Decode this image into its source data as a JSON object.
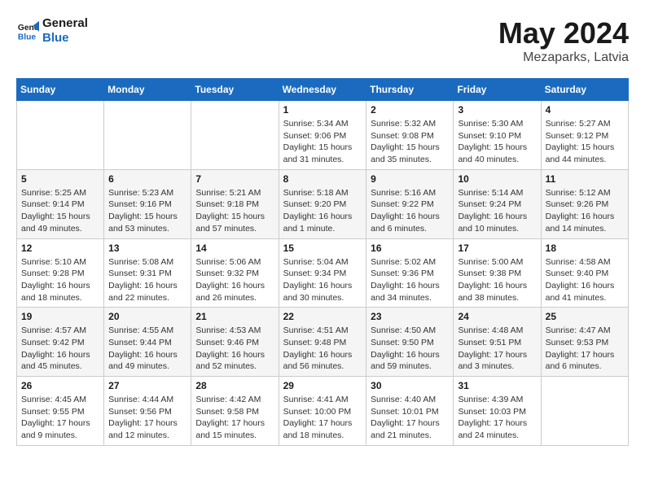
{
  "header": {
    "logo_line1": "General",
    "logo_line2": "Blue",
    "month": "May 2024",
    "location": "Mezaparks, Latvia"
  },
  "columns": [
    "Sunday",
    "Monday",
    "Tuesday",
    "Wednesday",
    "Thursday",
    "Friday",
    "Saturday"
  ],
  "weeks": [
    [
      {
        "day": "",
        "info": ""
      },
      {
        "day": "",
        "info": ""
      },
      {
        "day": "",
        "info": ""
      },
      {
        "day": "1",
        "info": "Sunrise: 5:34 AM\nSunset: 9:06 PM\nDaylight: 15 hours and 31 minutes."
      },
      {
        "day": "2",
        "info": "Sunrise: 5:32 AM\nSunset: 9:08 PM\nDaylight: 15 hours and 35 minutes."
      },
      {
        "day": "3",
        "info": "Sunrise: 5:30 AM\nSunset: 9:10 PM\nDaylight: 15 hours and 40 minutes."
      },
      {
        "day": "4",
        "info": "Sunrise: 5:27 AM\nSunset: 9:12 PM\nDaylight: 15 hours and 44 minutes."
      }
    ],
    [
      {
        "day": "5",
        "info": "Sunrise: 5:25 AM\nSunset: 9:14 PM\nDaylight: 15 hours and 49 minutes."
      },
      {
        "day": "6",
        "info": "Sunrise: 5:23 AM\nSunset: 9:16 PM\nDaylight: 15 hours and 53 minutes."
      },
      {
        "day": "7",
        "info": "Sunrise: 5:21 AM\nSunset: 9:18 PM\nDaylight: 15 hours and 57 minutes."
      },
      {
        "day": "8",
        "info": "Sunrise: 5:18 AM\nSunset: 9:20 PM\nDaylight: 16 hours and 1 minute."
      },
      {
        "day": "9",
        "info": "Sunrise: 5:16 AM\nSunset: 9:22 PM\nDaylight: 16 hours and 6 minutes."
      },
      {
        "day": "10",
        "info": "Sunrise: 5:14 AM\nSunset: 9:24 PM\nDaylight: 16 hours and 10 minutes."
      },
      {
        "day": "11",
        "info": "Sunrise: 5:12 AM\nSunset: 9:26 PM\nDaylight: 16 hours and 14 minutes."
      }
    ],
    [
      {
        "day": "12",
        "info": "Sunrise: 5:10 AM\nSunset: 9:28 PM\nDaylight: 16 hours and 18 minutes."
      },
      {
        "day": "13",
        "info": "Sunrise: 5:08 AM\nSunset: 9:31 PM\nDaylight: 16 hours and 22 minutes."
      },
      {
        "day": "14",
        "info": "Sunrise: 5:06 AM\nSunset: 9:32 PM\nDaylight: 16 hours and 26 minutes."
      },
      {
        "day": "15",
        "info": "Sunrise: 5:04 AM\nSunset: 9:34 PM\nDaylight: 16 hours and 30 minutes."
      },
      {
        "day": "16",
        "info": "Sunrise: 5:02 AM\nSunset: 9:36 PM\nDaylight: 16 hours and 34 minutes."
      },
      {
        "day": "17",
        "info": "Sunrise: 5:00 AM\nSunset: 9:38 PM\nDaylight: 16 hours and 38 minutes."
      },
      {
        "day": "18",
        "info": "Sunrise: 4:58 AM\nSunset: 9:40 PM\nDaylight: 16 hours and 41 minutes."
      }
    ],
    [
      {
        "day": "19",
        "info": "Sunrise: 4:57 AM\nSunset: 9:42 PM\nDaylight: 16 hours and 45 minutes."
      },
      {
        "day": "20",
        "info": "Sunrise: 4:55 AM\nSunset: 9:44 PM\nDaylight: 16 hours and 49 minutes."
      },
      {
        "day": "21",
        "info": "Sunrise: 4:53 AM\nSunset: 9:46 PM\nDaylight: 16 hours and 52 minutes."
      },
      {
        "day": "22",
        "info": "Sunrise: 4:51 AM\nSunset: 9:48 PM\nDaylight: 16 hours and 56 minutes."
      },
      {
        "day": "23",
        "info": "Sunrise: 4:50 AM\nSunset: 9:50 PM\nDaylight: 16 hours and 59 minutes."
      },
      {
        "day": "24",
        "info": "Sunrise: 4:48 AM\nSunset: 9:51 PM\nDaylight: 17 hours and 3 minutes."
      },
      {
        "day": "25",
        "info": "Sunrise: 4:47 AM\nSunset: 9:53 PM\nDaylight: 17 hours and 6 minutes."
      }
    ],
    [
      {
        "day": "26",
        "info": "Sunrise: 4:45 AM\nSunset: 9:55 PM\nDaylight: 17 hours and 9 minutes."
      },
      {
        "day": "27",
        "info": "Sunrise: 4:44 AM\nSunset: 9:56 PM\nDaylight: 17 hours and 12 minutes."
      },
      {
        "day": "28",
        "info": "Sunrise: 4:42 AM\nSunset: 9:58 PM\nDaylight: 17 hours and 15 minutes."
      },
      {
        "day": "29",
        "info": "Sunrise: 4:41 AM\nSunset: 10:00 PM\nDaylight: 17 hours and 18 minutes."
      },
      {
        "day": "30",
        "info": "Sunrise: 4:40 AM\nSunset: 10:01 PM\nDaylight: 17 hours and 21 minutes."
      },
      {
        "day": "31",
        "info": "Sunrise: 4:39 AM\nSunset: 10:03 PM\nDaylight: 17 hours and 24 minutes."
      },
      {
        "day": "",
        "info": ""
      }
    ]
  ]
}
